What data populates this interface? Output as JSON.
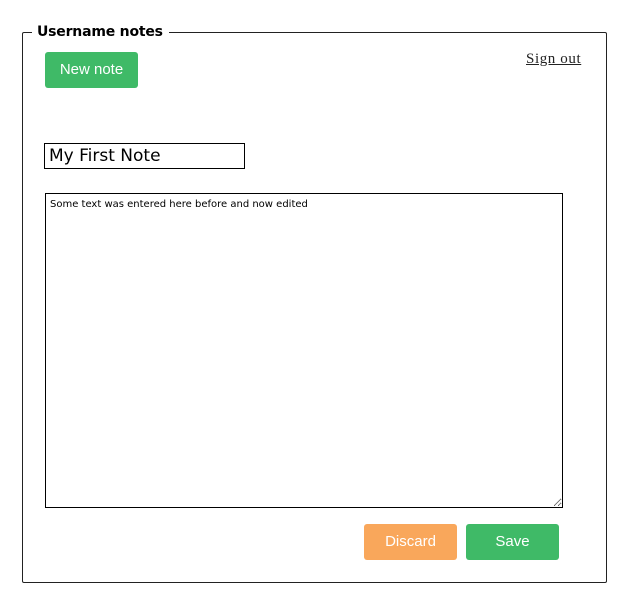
{
  "fieldset": {
    "legend": "Username notes"
  },
  "header": {
    "new_note_label": "New note",
    "sign_out_label": "Sign  out"
  },
  "note": {
    "title_value": "My First Note",
    "body_value": "Some text was entered here before and now edited"
  },
  "actions": {
    "discard_label": "Discard",
    "save_label": "Save"
  },
  "colors": {
    "primary_green": "#3fba67",
    "discard_orange": "#f9a75b"
  }
}
